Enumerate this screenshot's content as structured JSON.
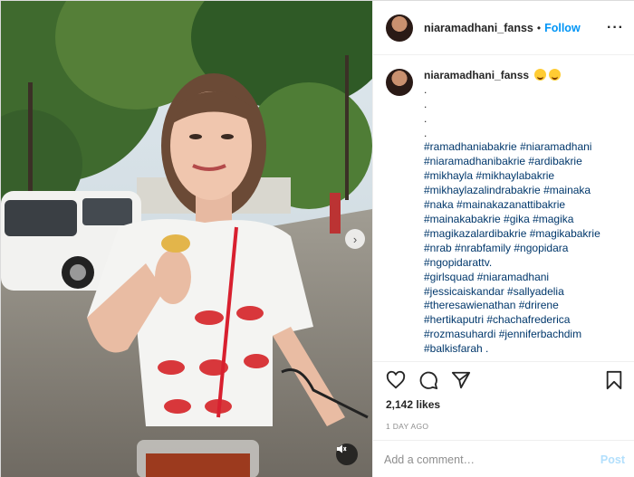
{
  "post": {
    "username": "niaramadhani_fanss",
    "follow_label": "Follow",
    "header_separator": "•",
    "more_label": "···",
    "caption_dots": [
      ".",
      ".",
      ".",
      "."
    ],
    "hashtag_lines": [
      "#ramadhaniabakrie #niaramadhani",
      "#niaramadhanibakrie #ardibakrie",
      "#mikhayla #mikhaylabakrie",
      "#mikhaylazalindrabakrie #mainaka",
      "#naka #mainakazanattibakrie",
      "#mainakabakrie #gika #magika",
      "#magikazalardibakrie #magikabakrie",
      "#nrab #nrabfamily #ngopidara",
      "#ngopidarattv.",
      "#girlsquad #niaramadhani",
      "#jessicaiskandar #sallyadelia",
      "#theresawienathan #drirene",
      "#hertikaputri #chachafrederica",
      "#rozmasuhardi #jenniferbachdim",
      "#balkisfarah ."
    ],
    "emojis": [
      "star-struck-emoji",
      "star-struck-emoji"
    ],
    "likes": "2,142 likes",
    "time": "1 DAY AGO",
    "comment_placeholder": "Add a comment…",
    "post_label": "Post"
  },
  "icons": {
    "like": "heart-icon",
    "comment": "comment-icon",
    "share": "paper-plane-icon",
    "save": "bookmark-icon",
    "next": "chevron-right-icon",
    "mute": "speaker-muted-icon"
  },
  "colors": {
    "accent": "#0095f6",
    "hashtag": "#00376b",
    "post_disabled": "#b2dffc",
    "muted_text": "#8e8e8e"
  }
}
